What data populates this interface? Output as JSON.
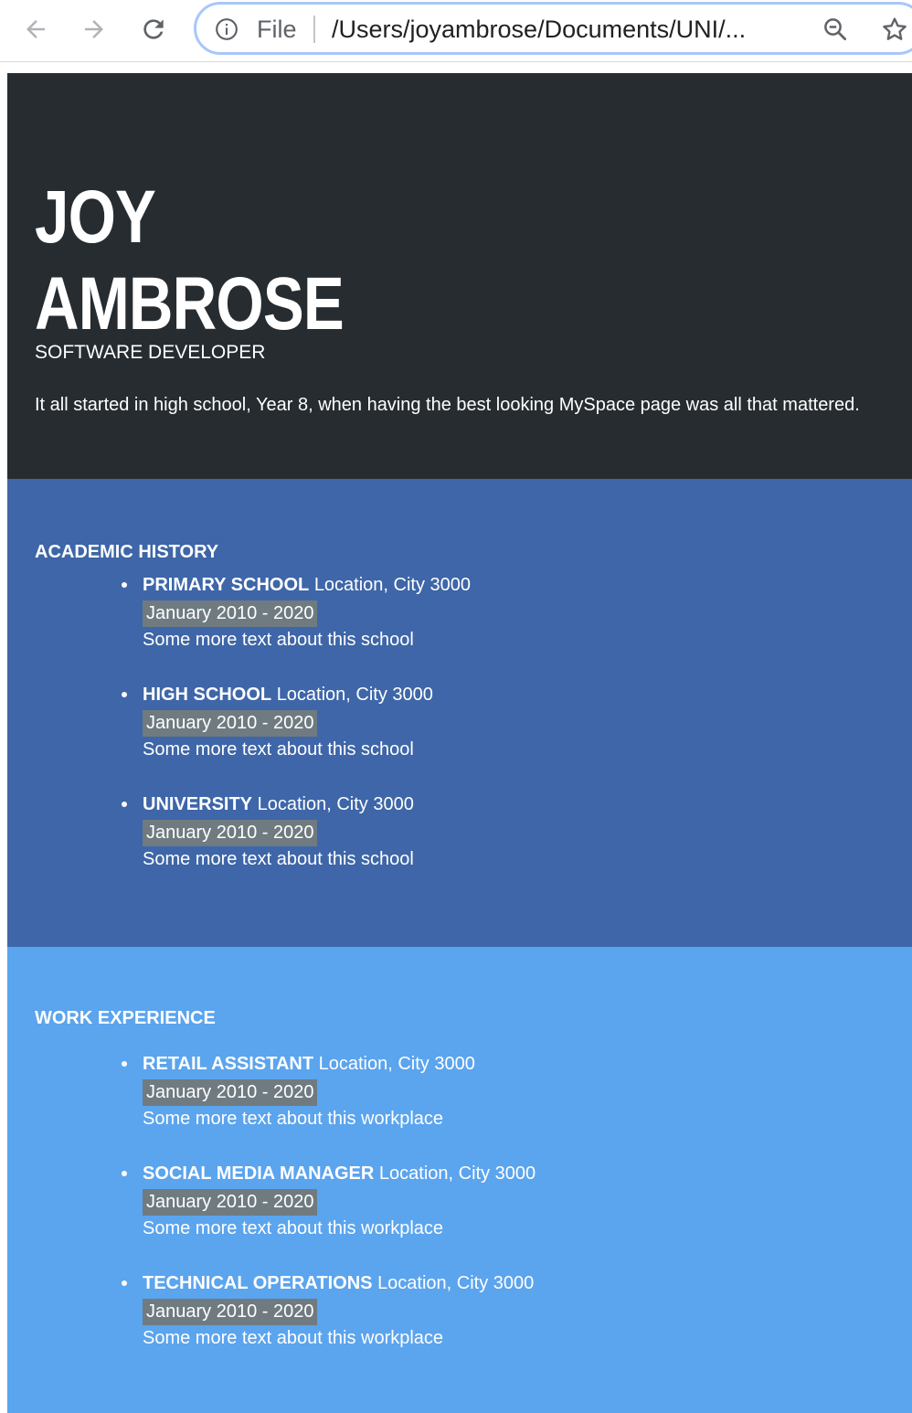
{
  "browser": {
    "address_scheme": "File",
    "address_url": "/Users/joyambrose/Documents/UNI/..."
  },
  "header": {
    "first_name": "JOY",
    "last_name": "AMBROSE",
    "job_title": "SOFTWARE DEVELOPER",
    "bio": "It all started in high school, Year 8, when having the best looking MySpace page was all that mattered.",
    "background_color": "#262c30"
  },
  "academic": {
    "heading": "ACADEMIC HISTORY",
    "background_color": "#3e66a8",
    "entries": [
      {
        "name": "PRIMARY SCHOOL",
        "location": "Location, City 3000",
        "date": "January 2010 - 2020",
        "desc": "Some more text about this school"
      },
      {
        "name": "HIGH SCHOOL",
        "location": "Location, City 3000",
        "date": "January 2010 - 2020",
        "desc": "Some more text about this school"
      },
      {
        "name": "UNIVERSITY",
        "location": "Location, City 3000",
        "date": "January 2010 - 2020",
        "desc": "Some more text about this school"
      }
    ]
  },
  "work": {
    "heading": "WORK EXPERIENCE",
    "background_color": "#5ba4ee",
    "entries": [
      {
        "name": "RETAIL ASSISTANT",
        "location": "Location, City 3000",
        "date": "January 2010 - 2020",
        "desc": "Some more text about this workplace"
      },
      {
        "name": "SOCIAL MEDIA MANAGER",
        "location": "Location, City 3000",
        "date": "January 2010 - 2020",
        "desc": "Some more text about this workplace"
      },
      {
        "name": "TECHNICAL OPERATIONS",
        "location": "Location, City 3000",
        "date": "January 2010 - 2020",
        "desc": "Some more text about this workplace"
      }
    ]
  },
  "date_badge_color": "#6f7b80"
}
